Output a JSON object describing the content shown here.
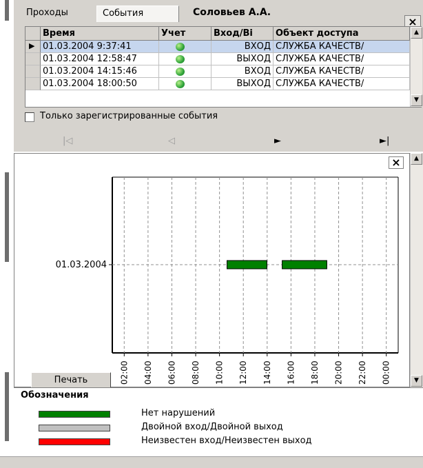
{
  "tabs": [
    {
      "label": "Проходы",
      "active": false
    },
    {
      "label": "События",
      "active": true
    }
  ],
  "person_name": "Соловьев А.А.",
  "close_glyph": "×",
  "events_table": {
    "columns": [
      "Время",
      "Учет",
      "Вход/Ві",
      "Объект доступа"
    ],
    "rows": [
      {
        "time": "01.03.2004 9:37:41",
        "accounted": true,
        "direction": "ВХОД",
        "object": "СЛУЖБА КАЧЕСТВ/",
        "selected": true
      },
      {
        "time": "01.03.2004 12:58:47",
        "accounted": true,
        "direction": "ВЫХОД",
        "object": "СЛУЖБА КАЧЕСТВ/",
        "selected": false
      },
      {
        "time": "01.03.2004 14:15:46",
        "accounted": true,
        "direction": "ВХОД",
        "object": "СЛУЖБА КАЧЕСТВ/",
        "selected": false
      },
      {
        "time": "01.03.2004 18:00:50",
        "accounted": true,
        "direction": "ВЫХОД",
        "object": "СЛУЖБА КАЧЕСТВ/",
        "selected": false
      }
    ]
  },
  "registered_only": {
    "label": "Только зарегистрированные события",
    "checked": false
  },
  "navigation": {
    "first": "first-record-icon",
    "prev": "prev-record-icon",
    "next": "next-record-icon",
    "last": "last-record-icon"
  },
  "chart_data": {
    "type": "timeline",
    "y_categories": [
      "01.03.2004"
    ],
    "x_ticks": [
      "02:00",
      "04:00",
      "06:00",
      "08:00",
      "10:00",
      "12:00",
      "14:00",
      "16:00",
      "18:00",
      "20:00",
      "22:00",
      "00:00"
    ],
    "x_range_hours": [
      0,
      24
    ],
    "bars": [
      {
        "category": "01.03.2004",
        "start": 9.63,
        "end": 12.98,
        "status": "Нет нарушений"
      },
      {
        "category": "01.03.2004",
        "start": 14.26,
        "end": 18.01,
        "status": "Нет нарушений"
      }
    ],
    "grid": true
  },
  "print_button": "Печать",
  "legend": {
    "title": "Обозначения",
    "items": [
      {
        "label": "Нет нарушений",
        "color": "#008000"
      },
      {
        "label": "Двойной вход/Двойной выход",
        "color": "#c0c0c0"
      },
      {
        "label": "Неизвестен вход/Неизвестен выход",
        "color": "#ff0000"
      }
    ]
  }
}
